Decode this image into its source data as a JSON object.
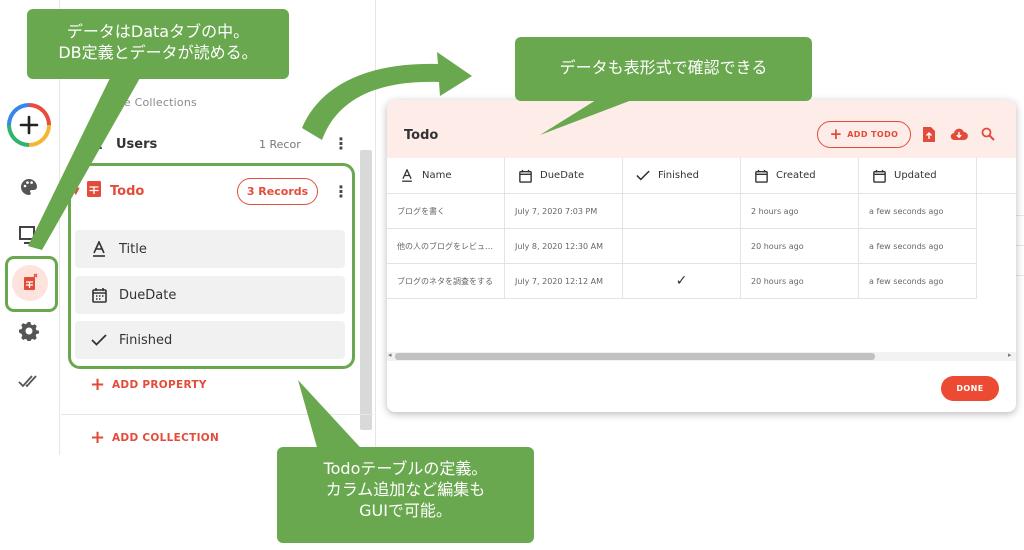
{
  "sidebar": {
    "icons": [
      "add-icon",
      "palette-icon",
      "monitor-icon",
      "database-icon",
      "gear-icon",
      "double-check-icon"
    ]
  },
  "collections": {
    "heading": "se Collections",
    "users": {
      "label": "Users",
      "count": "1 Recor"
    },
    "todo": {
      "label": "Todo",
      "records": "3 Records"
    },
    "properties": [
      {
        "label": "Title",
        "icon": "text-icon"
      },
      {
        "label": "DueDate",
        "icon": "calendar-icon"
      },
      {
        "label": "Finished",
        "icon": "check-icon"
      }
    ],
    "add_property": "ADD PROPERTY",
    "add_collection": "ADD COLLECTION"
  },
  "table": {
    "title": "Todo",
    "add_button": "ADD TODO",
    "columns": [
      "Name",
      "DueDate",
      "Finished",
      "Created",
      "Updated"
    ],
    "rows": [
      {
        "name": "ブログを書く",
        "due": "July 7, 2020 7:03 PM",
        "finished": "",
        "created": "2 hours ago",
        "updated": "a few seconds ago"
      },
      {
        "name": "他の人のブログをレビュ…",
        "due": "July 8, 2020 12:30 AM",
        "finished": "",
        "created": "20 hours ago",
        "updated": "a few seconds ago"
      },
      {
        "name": "ブログのネタを調査をする",
        "due": "July 7, 2020 12:12 AM",
        "finished": "✓",
        "created": "20 hours ago",
        "updated": "a few seconds ago"
      }
    ],
    "done_button": "DONE"
  },
  "callouts": {
    "top_left": [
      "データはDataタブの中。",
      "DB定義とデータが読める。"
    ],
    "top_right": [
      "データも表形式で確認できる"
    ],
    "bottom": [
      "Todoテーブルの定義。",
      "カラム追加など編集も",
      "GUIで可能。"
    ]
  },
  "colors": {
    "accent": "#e34c3a",
    "callout_green": "#6aa84f",
    "header_pink": "#fdece8"
  }
}
